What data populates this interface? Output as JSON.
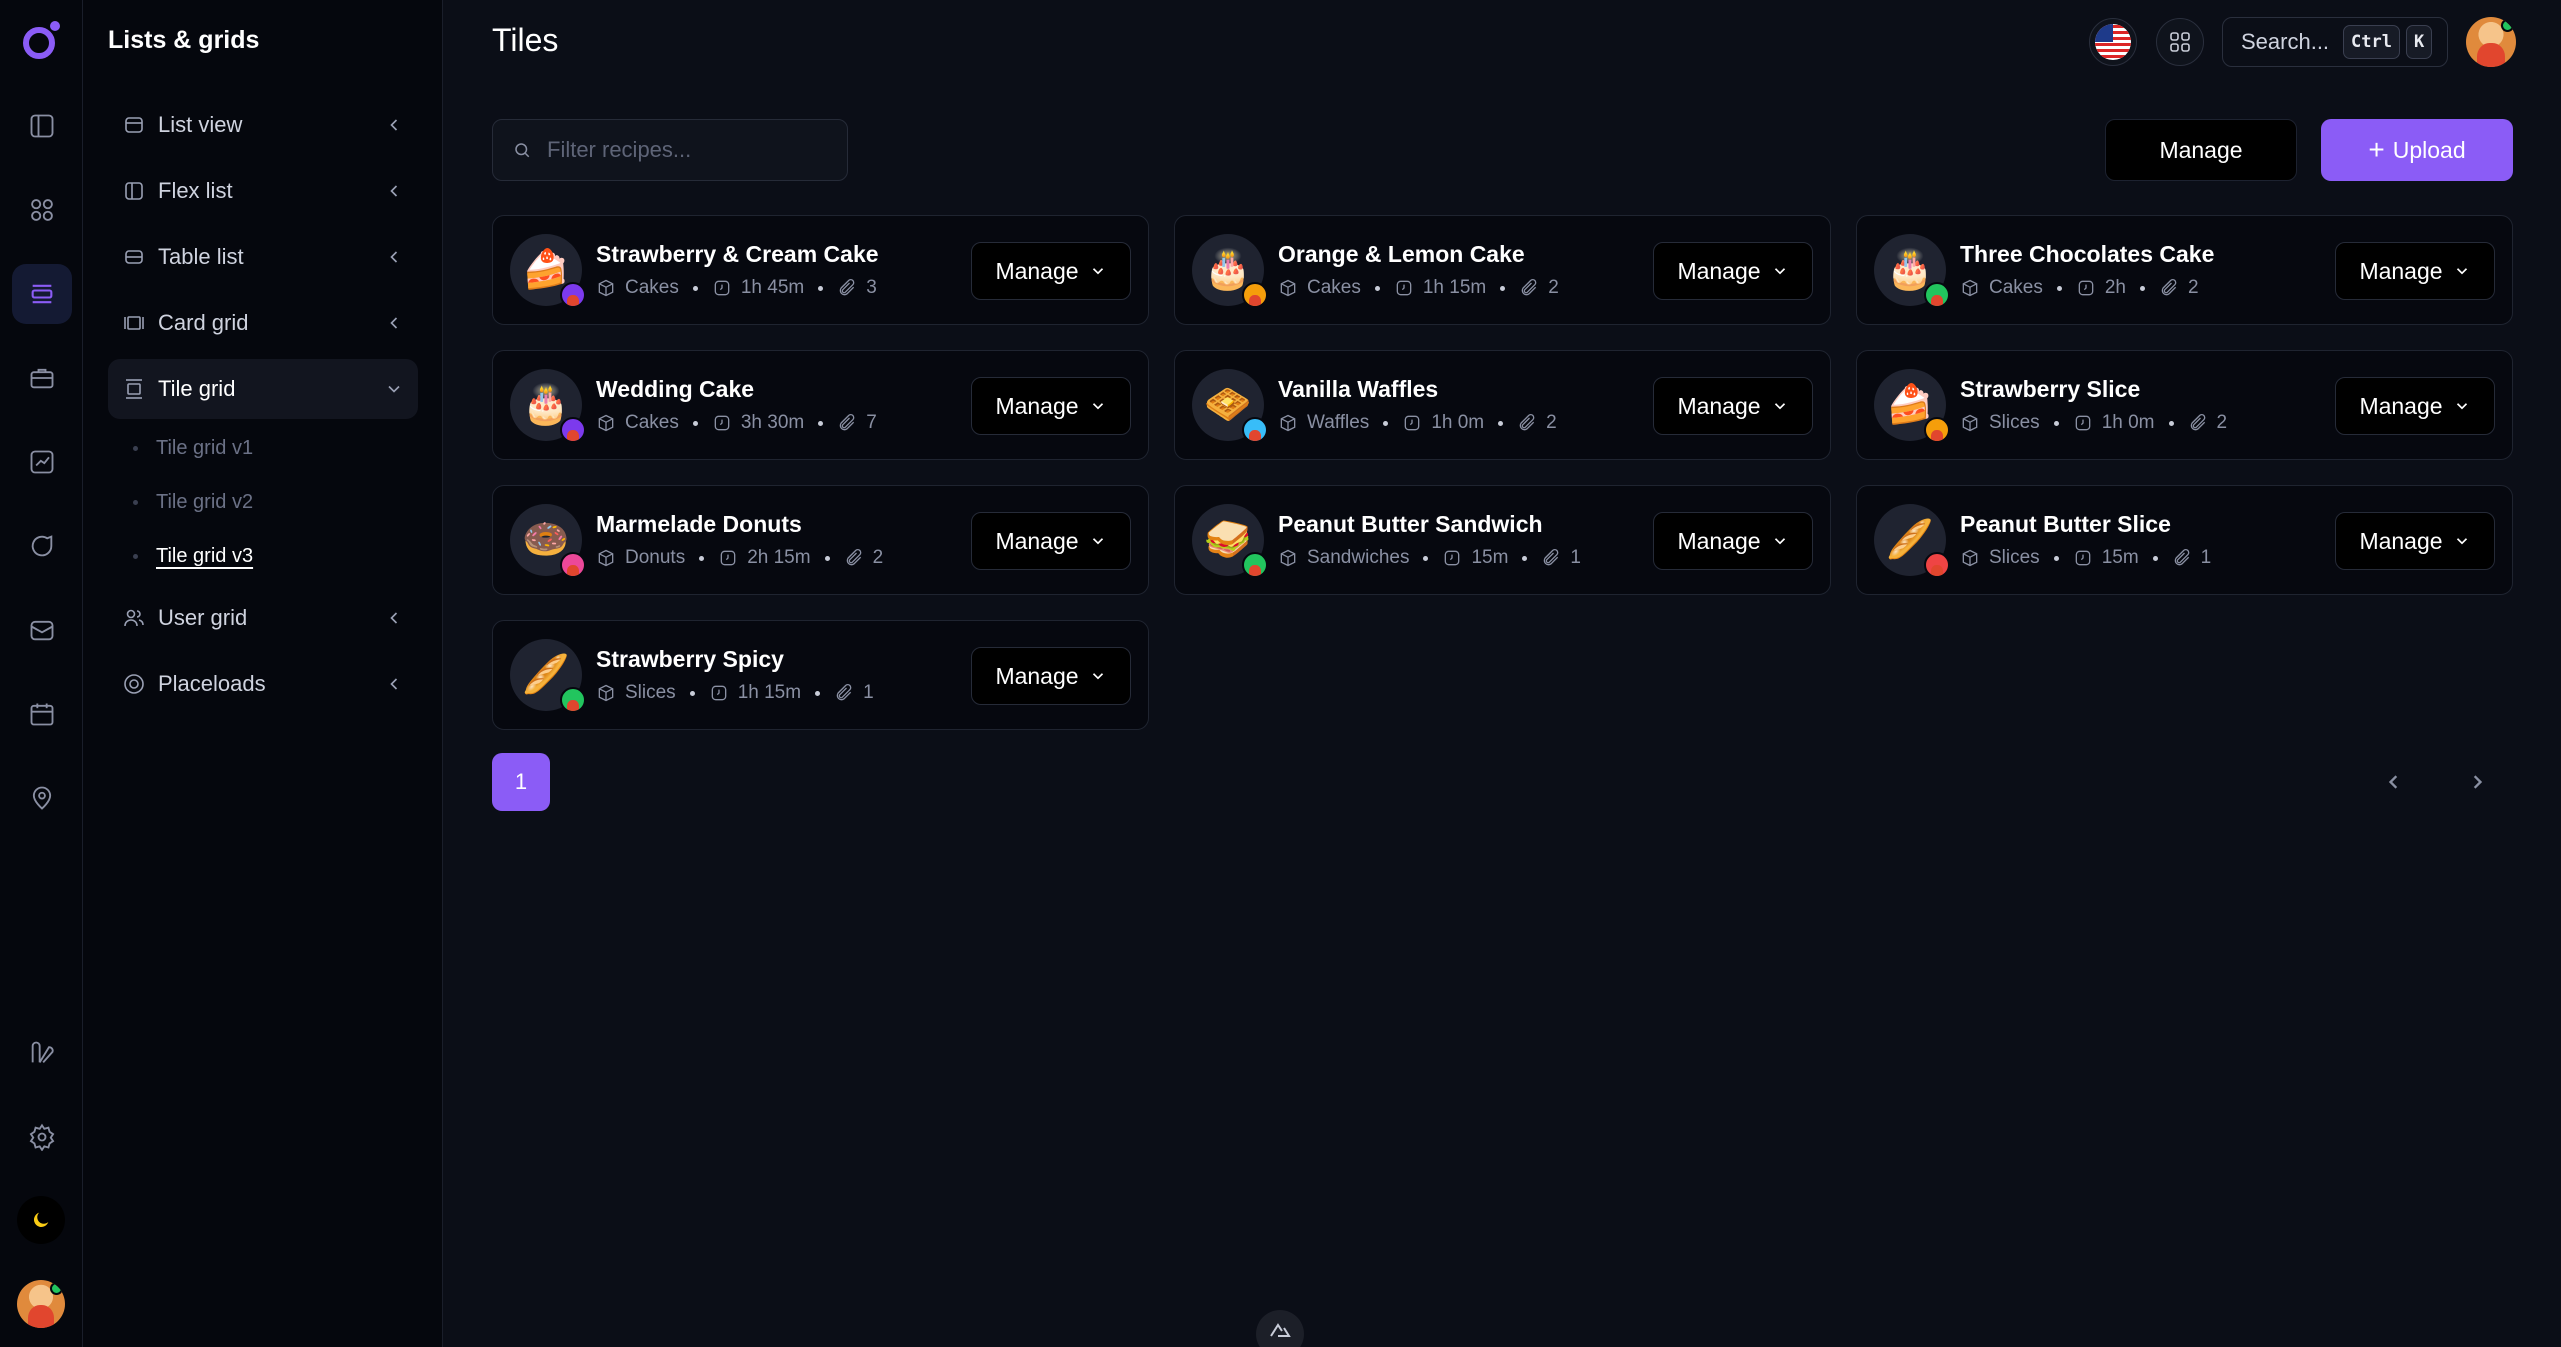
{
  "sidebar": {
    "title": "Lists & grids",
    "items": [
      {
        "label": "List view",
        "icon": "list-icon"
      },
      {
        "label": "Flex list",
        "icon": "flex-icon"
      },
      {
        "label": "Table list",
        "icon": "table-icon"
      },
      {
        "label": "Card grid",
        "icon": "card-icon"
      },
      {
        "label": "Tile grid",
        "icon": "tile-icon"
      },
      {
        "label": "User grid",
        "icon": "users-icon"
      },
      {
        "label": "Placeloads",
        "icon": "placeload-icon"
      }
    ],
    "subitems": [
      "Tile grid v1",
      "Tile grid v2",
      "Tile grid v3"
    ],
    "active_subitem": "Tile grid v3"
  },
  "header": {
    "title": "Tiles",
    "search_label": "Search...",
    "kbd_ctrl": "Ctrl",
    "kbd_k": "K"
  },
  "toolbar": {
    "filter_placeholder": "Filter recipes...",
    "manage_label": "Manage",
    "upload_label": "Upload"
  },
  "tiles": [
    {
      "name": "Strawberry & Cream Cake",
      "category": "Cakes",
      "time": "1h 45m",
      "attachments": "3",
      "emoji": "🍰",
      "badge": "#7c3aed"
    },
    {
      "name": "Orange & Lemon Cake",
      "category": "Cakes",
      "time": "1h 15m",
      "attachments": "2",
      "emoji": "🎂",
      "badge": "#f59e0b"
    },
    {
      "name": "Three Chocolates Cake",
      "category": "Cakes",
      "time": "2h",
      "attachments": "2",
      "emoji": "🎂",
      "badge": "#22c55e"
    },
    {
      "name": "Wedding Cake",
      "category": "Cakes",
      "time": "3h 30m",
      "attachments": "7",
      "emoji": "🎂",
      "badge": "#7c3aed"
    },
    {
      "name": "Vanilla Waffles",
      "category": "Waffles",
      "time": "1h 0m",
      "attachments": "2",
      "emoji": "🧇",
      "badge": "#38bdf8"
    },
    {
      "name": "Strawberry Slice",
      "category": "Slices",
      "time": "1h 0m",
      "attachments": "2",
      "emoji": "🍰",
      "badge": "#f59e0b"
    },
    {
      "name": "Marmelade Donuts",
      "category": "Donuts",
      "time": "2h 15m",
      "attachments": "2",
      "emoji": "🍩",
      "badge": "#ec4899"
    },
    {
      "name": "Peanut Butter Sandwich",
      "category": "Sandwiches",
      "time": "15m",
      "attachments": "1",
      "emoji": "🥪",
      "badge": "#22c55e"
    },
    {
      "name": "Peanut Butter Slice",
      "category": "Slices",
      "time": "15m",
      "attachments": "1",
      "emoji": "🥖",
      "badge": "#ef4444"
    },
    {
      "name": "Strawberry Spicy",
      "category": "Slices",
      "time": "1h 15m",
      "attachments": "1",
      "emoji": "🥖",
      "badge": "#22c55e"
    }
  ],
  "tile_manage_label": "Manage",
  "pagination": {
    "current": "1"
  },
  "colors": {
    "accent": "#8b5cf6",
    "background": "#0b0e17",
    "panel": "#05070d"
  }
}
